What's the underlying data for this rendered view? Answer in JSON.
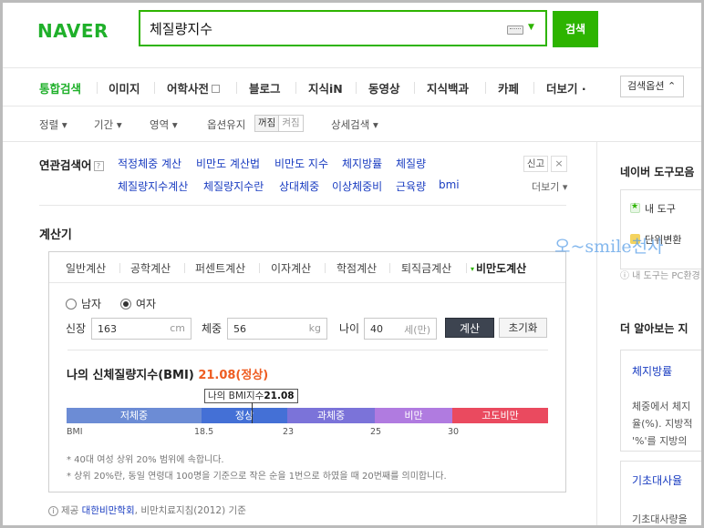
{
  "header": {
    "logo": "NAVER",
    "search_value": "체질량지수",
    "search_button": "검색"
  },
  "tabs": {
    "items": [
      "통합검색",
      "이미지",
      "어학사전",
      "블로그",
      "지식iN",
      "동영상",
      "지식백과",
      "카페",
      "더보기 ·"
    ],
    "search_options": "검색옵션 ⌃"
  },
  "filters": {
    "sort": "정렬 ▾",
    "period": "기간 ▾",
    "area": "영역 ▾",
    "option_keep": "옵션유지",
    "toggle_off": "꺼짐",
    "toggle_on": "켜짐",
    "detail_search": "상세검색 ▾"
  },
  "related": {
    "title": "연관검색어",
    "help": "?",
    "row1": [
      "적정체중 계산",
      "비만도 계산법",
      "비만도 지수",
      "체지방률",
      "체질량"
    ],
    "row2": [
      "체질량지수계산",
      "체질량지수란",
      "상대체중",
      "이상체중비",
      "근육량",
      "bmi"
    ],
    "report": "신고",
    "close": "×",
    "more": "더보기 ▾"
  },
  "calculator": {
    "section_title": "계산기",
    "tabs": [
      "일반계산",
      "공학계산",
      "퍼센트계산",
      "이자계산",
      "학점계산",
      "퇴직금계산",
      "비만도계산"
    ],
    "active_marker": "▾",
    "gender_male": "남자",
    "gender_female": "여자",
    "height_label": "신장",
    "height_value": "163",
    "height_unit": "cm",
    "weight_label": "체중",
    "weight_value": "56",
    "weight_unit": "kg",
    "age_label": "나이",
    "age_value": "40",
    "age_unit": "세(만)",
    "calc_button": "계산",
    "reset_button": "초기화",
    "result_prefix": "나의 신체질량지수(BMI)",
    "result_value": "21.08(정상)",
    "tooltip_label": "나의 BMI지수",
    "tooltip_value": "21.08",
    "bmi_value": 21.08,
    "segments": [
      {
        "label": "저체중",
        "color": "#6c8cd5"
      },
      {
        "label": "정상",
        "color": "#4470d6"
      },
      {
        "label": "과체중",
        "color": "#7b73d9"
      },
      {
        "label": "비만",
        "color": "#b07be0"
      },
      {
        "label": "고도비만",
        "color": "#ea4a5f"
      }
    ],
    "ticks": [
      "BMI",
      "18.5",
      "23",
      "25",
      "30"
    ],
    "note1": "* 40대 여성 상위 20% 범위에 속합니다.",
    "note2": "* 상위 20%란, 동일 연령대 100명을 기준으로 작은 순을 1번으로 하였을 때 20번째를 의미합니다.",
    "source_prefix": "제공",
    "source_org": "대한비만학회",
    "source_suffix": ", 비만치료지침(2012) 기준"
  },
  "right_panel": {
    "tools_title": "네이버 도구모음",
    "tool_1": "내 도구",
    "tool_2": "단위변환",
    "tools_note": "ⓘ 내 도구는 PC환경",
    "more_title": "더 알아보는 지",
    "card1_title": "체지방률",
    "card1_line1": "체중에서 체지",
    "card1_line2": "율(%). 지방적",
    "card1_line3": "'%'를 지방의",
    "card2_title": "기초대사율",
    "card2_line1": "기초대사량을"
  },
  "watermark": "오~smile천사"
}
